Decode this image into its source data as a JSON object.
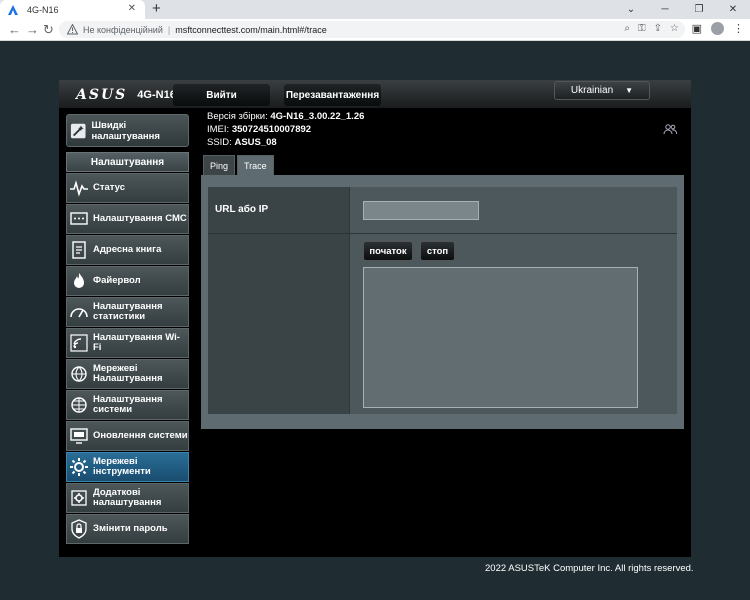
{
  "browser": {
    "tab_title": "4G-N16",
    "new_tab_symbol": "+",
    "not_secure_text": "Не конфіденційний",
    "url": "msftconnecttest.com/main.html#/trace"
  },
  "header": {
    "brand": "ASUS",
    "model": "4G-N16",
    "logout_label": "Вийти",
    "reboot_label": "Перезавантаження",
    "language": "Ukrainian"
  },
  "sidebar": {
    "quick_setup_label": "Швидкі налаштування",
    "settings_header": "Налаштування",
    "items": [
      {
        "label": "Статус",
        "icon": "pulse-icon"
      },
      {
        "label": "Налаштування СМС",
        "icon": "sms-icon"
      },
      {
        "label": "Адресна книга",
        "icon": "address-book-icon"
      },
      {
        "label": "Файервол",
        "icon": "firewall-icon"
      },
      {
        "label": "Налаштування статистики",
        "icon": "statistics-icon"
      },
      {
        "label": "Налаштування Wi-Fi",
        "icon": "wifi-icon"
      },
      {
        "label": "Мережеві Налаштування",
        "icon": "network-globe-icon"
      },
      {
        "label": "Налаштування системи",
        "icon": "system-globe-icon"
      },
      {
        "label": "Оновлення системи",
        "icon": "update-monitor-icon"
      },
      {
        "label": "Мережеві інструменти",
        "icon": "network-tools-icon",
        "active": true
      },
      {
        "label": "Додаткові налаштування",
        "icon": "advanced-settings-icon"
      },
      {
        "label": "Змінити пароль",
        "icon": "lock-icon"
      }
    ]
  },
  "info": {
    "build_label": "Версія збірки:",
    "build_value": "4G-N16_3.00.22_1.26",
    "imei_label": "IMEI:",
    "imei_value": "350724510007892",
    "ssid_label": "SSID:",
    "ssid_value": "ASUS_08"
  },
  "tabs": [
    {
      "label": "Ping",
      "active": false
    },
    {
      "label": "Trace",
      "active": true
    }
  ],
  "trace": {
    "url_label": "URL або IP",
    "url_value": "",
    "start_label": "початок",
    "stop_label": "стоп",
    "output": ""
  },
  "footer": {
    "copyright": "2022 ASUSTeK Computer Inc. All rights reserved."
  }
}
